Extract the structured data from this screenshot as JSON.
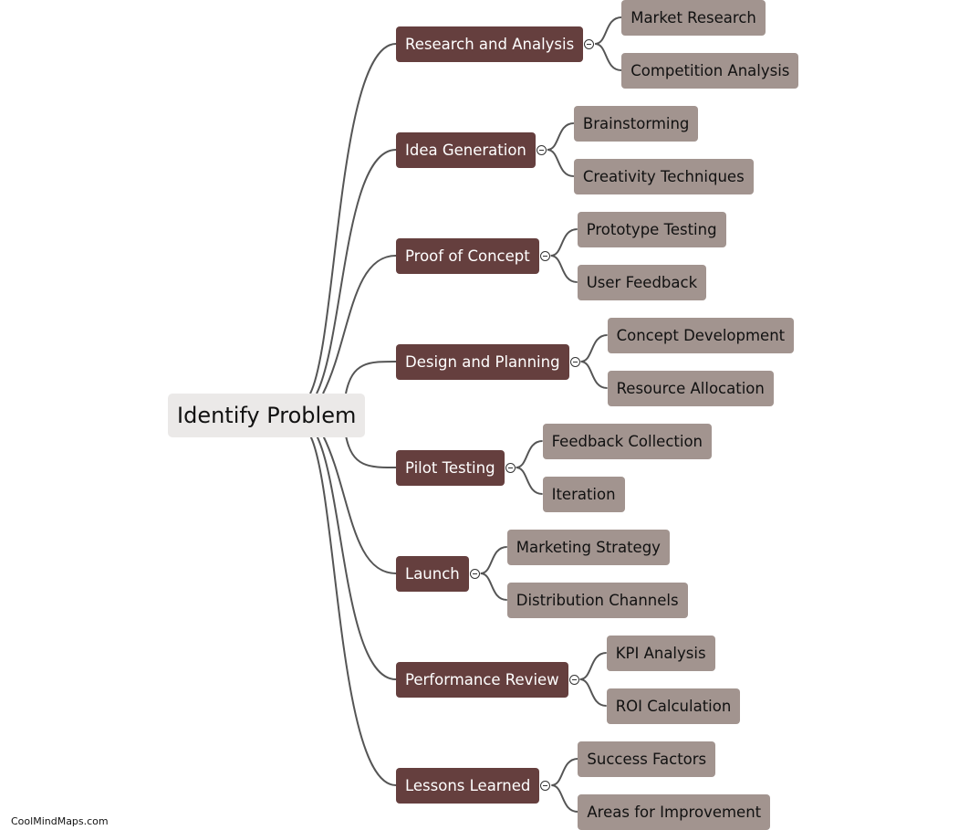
{
  "root": {
    "label": "Identify Problem"
  },
  "branches": [
    {
      "label": "Research and Analysis",
      "children": [
        "Market Research",
        "Competition Analysis"
      ]
    },
    {
      "label": "Idea Generation",
      "children": [
        "Brainstorming",
        "Creativity Techniques"
      ]
    },
    {
      "label": "Proof of Concept",
      "children": [
        "Prototype Testing",
        "User Feedback"
      ]
    },
    {
      "label": "Design and Planning",
      "children": [
        "Concept Development",
        "Resource Allocation"
      ]
    },
    {
      "label": "Pilot Testing",
      "children": [
        "Feedback Collection",
        "Iteration"
      ]
    },
    {
      "label": "Launch",
      "children": [
        "Marketing Strategy",
        "Distribution Channels"
      ]
    },
    {
      "label": "Performance Review",
      "children": [
        "KPI Analysis",
        "ROI Calculation"
      ]
    },
    {
      "label": "Lessons Learned",
      "children": [
        "Success Factors",
        "Areas for Improvement"
      ]
    }
  ],
  "watermark": "CoolMindMaps.com",
  "colors": {
    "root_bg": "#ebe9e8",
    "branch_bg": "#653f3e",
    "leaf_bg": "#a2948f",
    "link": "#555555"
  }
}
